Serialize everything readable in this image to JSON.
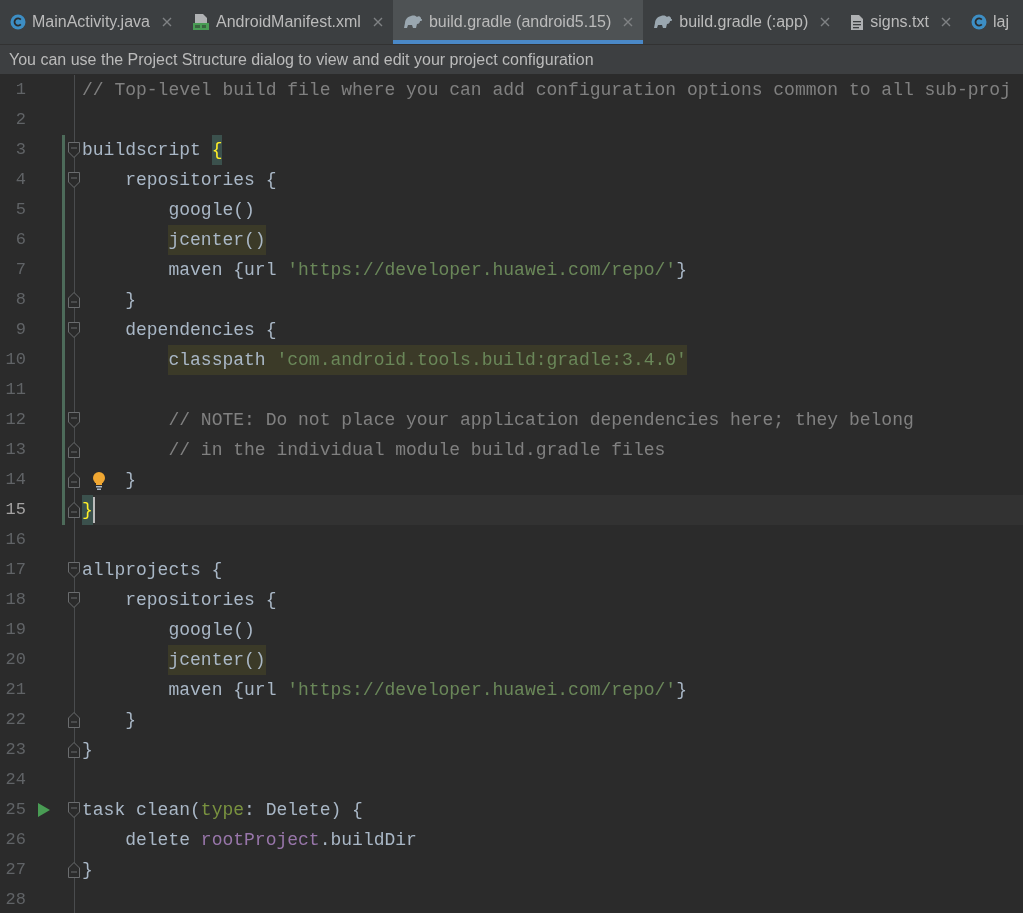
{
  "tabs": [
    {
      "label": "MainActivity.java",
      "kind": "class",
      "selected": false,
      "closable": true
    },
    {
      "label": "AndroidManifest.xml",
      "kind": "manifest",
      "selected": false,
      "closable": true
    },
    {
      "label": "build.gradle (android5.15)",
      "kind": "gradle",
      "selected": true,
      "closable": true
    },
    {
      "label": "build.gradle (:app)",
      "kind": "gradle",
      "selected": false,
      "closable": true
    },
    {
      "label": "signs.txt",
      "kind": "text",
      "selected": false,
      "closable": true
    },
    {
      "label": "laj",
      "kind": "class",
      "selected": false,
      "closable": false
    }
  ],
  "notification": "You can use the Project Structure dialog to view and edit your project configuration",
  "editor": {
    "lines": [
      {
        "number": "1",
        "current": false,
        "changed": false,
        "tokens": [
          {
            "text": "// Top-level build file where you can add configuration options common to all sub-proj",
            "kind": "comment"
          }
        ]
      },
      {
        "number": "2",
        "current": false,
        "changed": false
      },
      {
        "number": "3",
        "current": false,
        "changed": true,
        "fold": {
          "kind": "open"
        },
        "tokens": [
          {
            "text": "buildscript ",
            "kind": "plain"
          },
          {
            "text": "{",
            "kind": "brace_match"
          }
        ]
      },
      {
        "number": "4",
        "current": false,
        "changed": true,
        "fold": {
          "kind": "open"
        },
        "tokens": [
          {
            "text": "    repositories {",
            "kind": "plain"
          }
        ]
      },
      {
        "number": "5",
        "current": false,
        "changed": true,
        "tokens": [
          {
            "text": "        google()",
            "kind": "plain"
          }
        ]
      },
      {
        "number": "6",
        "current": false,
        "changed": true,
        "tokens": [
          {
            "text": "        jcenter()",
            "kind": "plain",
            "highlight": true
          }
        ]
      },
      {
        "number": "7",
        "current": false,
        "changed": true,
        "tokens": [
          {
            "text": "        maven {url ",
            "kind": "plain"
          },
          {
            "text": "'https://developer.huawei.com/repo/'",
            "kind": "string"
          },
          {
            "text": "}",
            "kind": "plain"
          }
        ]
      },
      {
        "number": "8",
        "current": false,
        "changed": true,
        "fold": {
          "kind": "close"
        },
        "tokens": [
          {
            "text": "    }",
            "kind": "plain"
          }
        ]
      },
      {
        "number": "9",
        "current": false,
        "changed": true,
        "fold": {
          "kind": "open"
        },
        "tokens": [
          {
            "text": "    dependencies {",
            "kind": "plain"
          }
        ]
      },
      {
        "number": "10",
        "current": false,
        "changed": true,
        "tokens": [
          {
            "text": "        classpath ",
            "kind": "plain",
            "highlight": true
          },
          {
            "text": "'com.android.tools.build:gradle:3.4.0'",
            "kind": "string",
            "highlight": true
          }
        ]
      },
      {
        "number": "11",
        "current": false,
        "changed": true
      },
      {
        "number": "12",
        "current": false,
        "changed": true,
        "fold": {
          "kind": "open"
        },
        "tokens": [
          {
            "text": "        // NOTE: Do not place your application dependencies here; they belong",
            "kind": "comment"
          }
        ]
      },
      {
        "number": "13",
        "current": false,
        "changed": true,
        "fold": {
          "kind": "close"
        },
        "tokens": [
          {
            "text": "        // in the individual module build.gradle files",
            "kind": "comment"
          }
        ]
      },
      {
        "number": "14",
        "current": false,
        "changed": true,
        "fold": {
          "kind": "close"
        },
        "marker": {
          "kind": "bulb"
        },
        "tokens": [
          {
            "text": "    }",
            "kind": "plain"
          }
        ]
      },
      {
        "number": "15",
        "current": true,
        "changed": true,
        "fold": {
          "kind": "close"
        },
        "tokens": [
          {
            "text": "}",
            "kind": "brace_match"
          }
        ]
      },
      {
        "number": "16",
        "current": false,
        "changed": false
      },
      {
        "number": "17",
        "current": false,
        "changed": false,
        "fold": {
          "kind": "open"
        },
        "tokens": [
          {
            "text": "allprojects {",
            "kind": "plain"
          }
        ]
      },
      {
        "number": "18",
        "current": false,
        "changed": false,
        "fold": {
          "kind": "open"
        },
        "tokens": [
          {
            "text": "    repositories {",
            "kind": "plain"
          }
        ]
      },
      {
        "number": "19",
        "current": false,
        "changed": false,
        "tokens": [
          {
            "text": "        google()",
            "kind": "plain"
          }
        ]
      },
      {
        "number": "20",
        "current": false,
        "changed": false,
        "tokens": [
          {
            "text": "        jcenter()",
            "kind": "plain",
            "highlight": true
          }
        ]
      },
      {
        "number": "21",
        "current": false,
        "changed": false,
        "tokens": [
          {
            "text": "        maven {url ",
            "kind": "plain"
          },
          {
            "text": "'https://developer.huawei.com/repo/'",
            "kind": "string"
          },
          {
            "text": "}",
            "kind": "plain"
          }
        ]
      },
      {
        "number": "22",
        "current": false,
        "changed": false,
        "fold": {
          "kind": "close"
        },
        "tokens": [
          {
            "text": "    }",
            "kind": "plain"
          }
        ]
      },
      {
        "number": "23",
        "current": false,
        "changed": false,
        "fold": {
          "kind": "close"
        },
        "tokens": [
          {
            "text": "}",
            "kind": "plain"
          }
        ]
      },
      {
        "number": "24",
        "current": false,
        "changed": false
      },
      {
        "number": "25",
        "current": false,
        "changed": false,
        "fold": {
          "kind": "open"
        },
        "marker": {
          "kind": "run"
        },
        "tokens": [
          {
            "text": "task clean(",
            "kind": "plain"
          },
          {
            "text": "type",
            "kind": "param"
          },
          {
            "text": ": Delete) {",
            "kind": "plain"
          }
        ]
      },
      {
        "number": "26",
        "current": false,
        "changed": false,
        "tokens": [
          {
            "text": "    delete ",
            "kind": "plain"
          },
          {
            "text": "rootProject",
            "kind": "field"
          },
          {
            "text": ".buildDir",
            "kind": "plain"
          }
        ]
      },
      {
        "number": "27",
        "current": false,
        "changed": false,
        "fold": {
          "kind": "close"
        },
        "tokens": [
          {
            "text": "}",
            "kind": "plain"
          }
        ]
      },
      {
        "number": "28",
        "current": false,
        "changed": false
      }
    ]
  }
}
